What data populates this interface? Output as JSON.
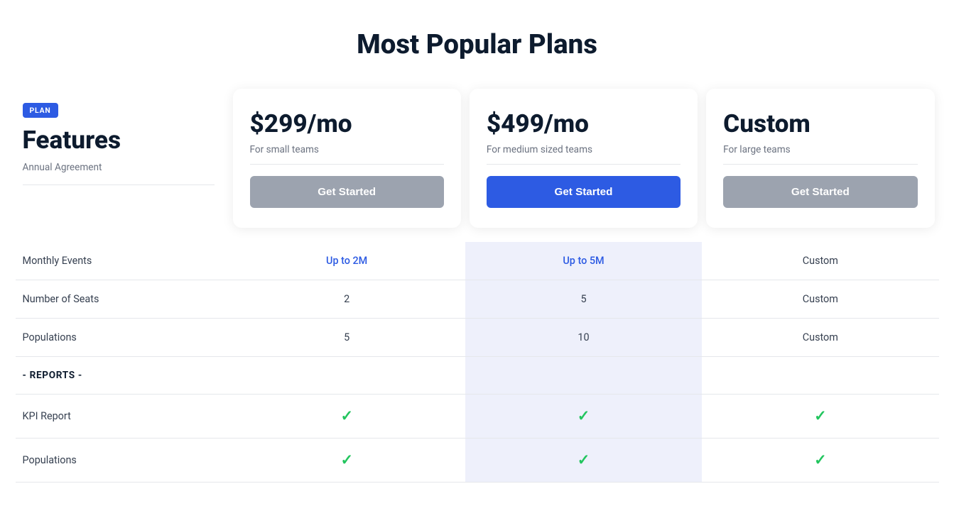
{
  "page": {
    "title": "Most Popular Plans"
  },
  "features_col": {
    "badge": "PLAN",
    "title": "Features",
    "subtitle": "Annual Agreement"
  },
  "plans": [
    {
      "id": "small",
      "price": "$299/mo",
      "description": "For small teams",
      "btn_label": "Get Started",
      "btn_style": "default",
      "highlighted": false
    },
    {
      "id": "medium",
      "price": "$499/mo",
      "description": "For medium sized teams",
      "btn_label": "Get Started",
      "btn_style": "primary",
      "highlighted": true
    },
    {
      "id": "large",
      "price": "Custom",
      "description": "For large teams",
      "btn_label": "Get Started",
      "btn_style": "default",
      "highlighted": false
    }
  ],
  "feature_rows": [
    {
      "label": "Monthly Events",
      "values": [
        "Up to 2M",
        "Up to 5M",
        "Custom"
      ],
      "value_types": [
        "blue",
        "blue-highlighted",
        "plain"
      ],
      "is_check": false
    },
    {
      "label": "Number of Seats",
      "values": [
        "2",
        "5",
        "Custom"
      ],
      "value_types": [
        "plain",
        "highlighted",
        "plain"
      ],
      "is_check": false
    },
    {
      "label": "Populations",
      "values": [
        "5",
        "10",
        "Custom"
      ],
      "value_types": [
        "plain",
        "highlighted",
        "plain"
      ],
      "is_check": false
    },
    {
      "label": "- REPORTS -",
      "values": [
        "",
        "",
        ""
      ],
      "value_types": [
        "plain",
        "highlighted",
        "plain"
      ],
      "is_check": false,
      "is_section_header": true
    },
    {
      "label": "KPI Report",
      "values": [
        "✓",
        "✓",
        "✓"
      ],
      "value_types": [
        "plain",
        "highlighted",
        "plain"
      ],
      "is_check": true
    },
    {
      "label": "Populations",
      "values": [
        "✓",
        "✓",
        "✓"
      ],
      "value_types": [
        "plain",
        "highlighted",
        "plain"
      ],
      "is_check": true
    }
  ]
}
